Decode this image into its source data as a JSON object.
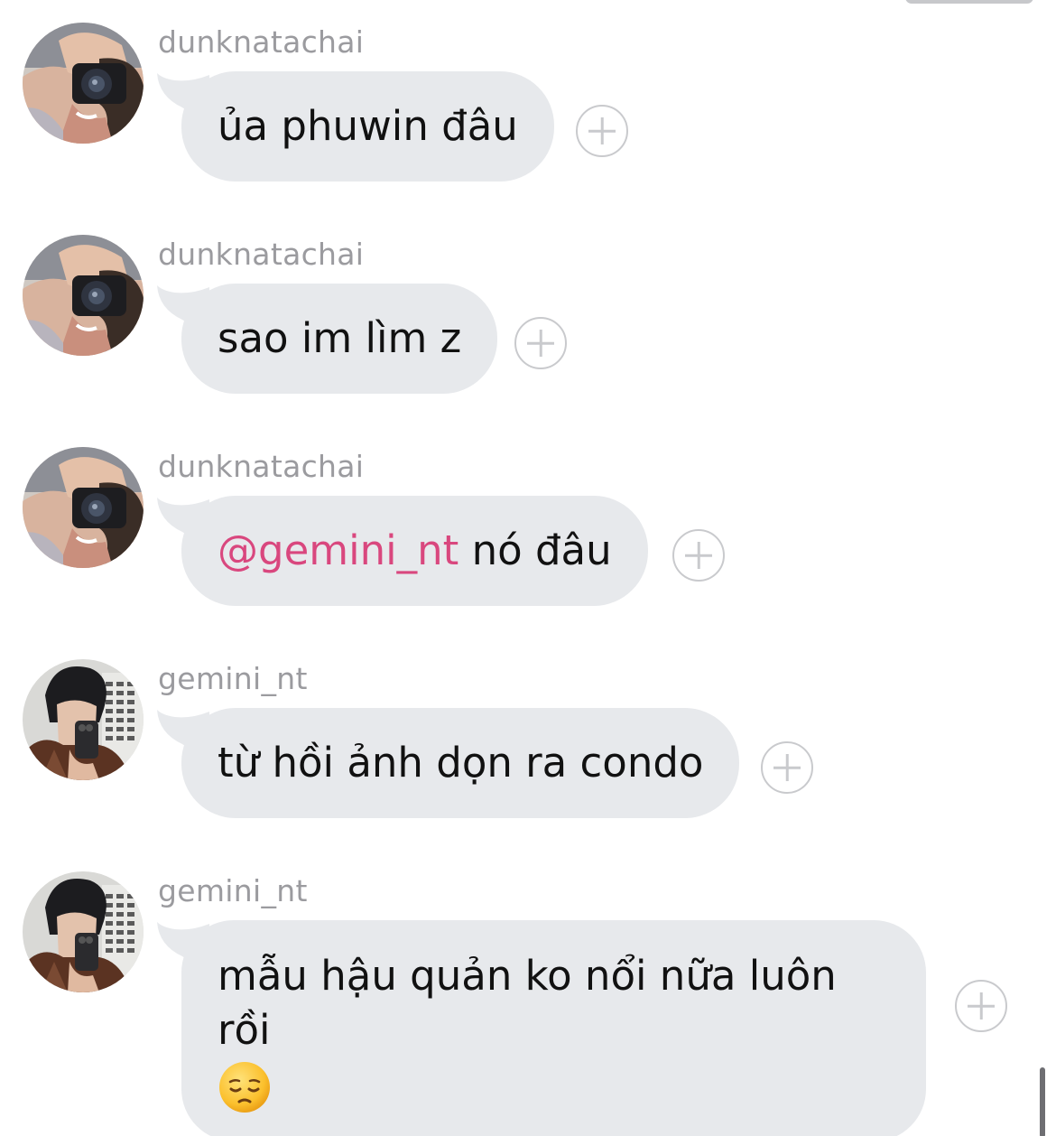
{
  "messages": [
    {
      "username": "dunknatachai",
      "text": "ủa phuwin đâu",
      "avatar": "camera-selfie-avatar"
    },
    {
      "username": "dunknatachai",
      "text": "sao im lìm z",
      "avatar": "camera-selfie-avatar"
    },
    {
      "username": "dunknatachai",
      "mention": "@gemini_nt",
      "text": " nó đâu",
      "avatar": "camera-selfie-avatar"
    },
    {
      "username": "gemini_nt",
      "text": "từ hồi ảnh dọn ra condo",
      "avatar": "mirror-selfie-avatar"
    },
    {
      "username": "gemini_nt",
      "text": "mẫu hậu quản ko nổi nữa luôn rồi",
      "emoji": "pensive-face",
      "avatar": "mirror-selfie-avatar"
    }
  ],
  "icons": {
    "add_reaction": "plus-circle-icon",
    "emoji": "pensive-face-emoji"
  },
  "colors": {
    "bubble": "#e7e9ec",
    "username": "#9b9b9f",
    "mention": "#d9477e",
    "text": "#111111"
  }
}
